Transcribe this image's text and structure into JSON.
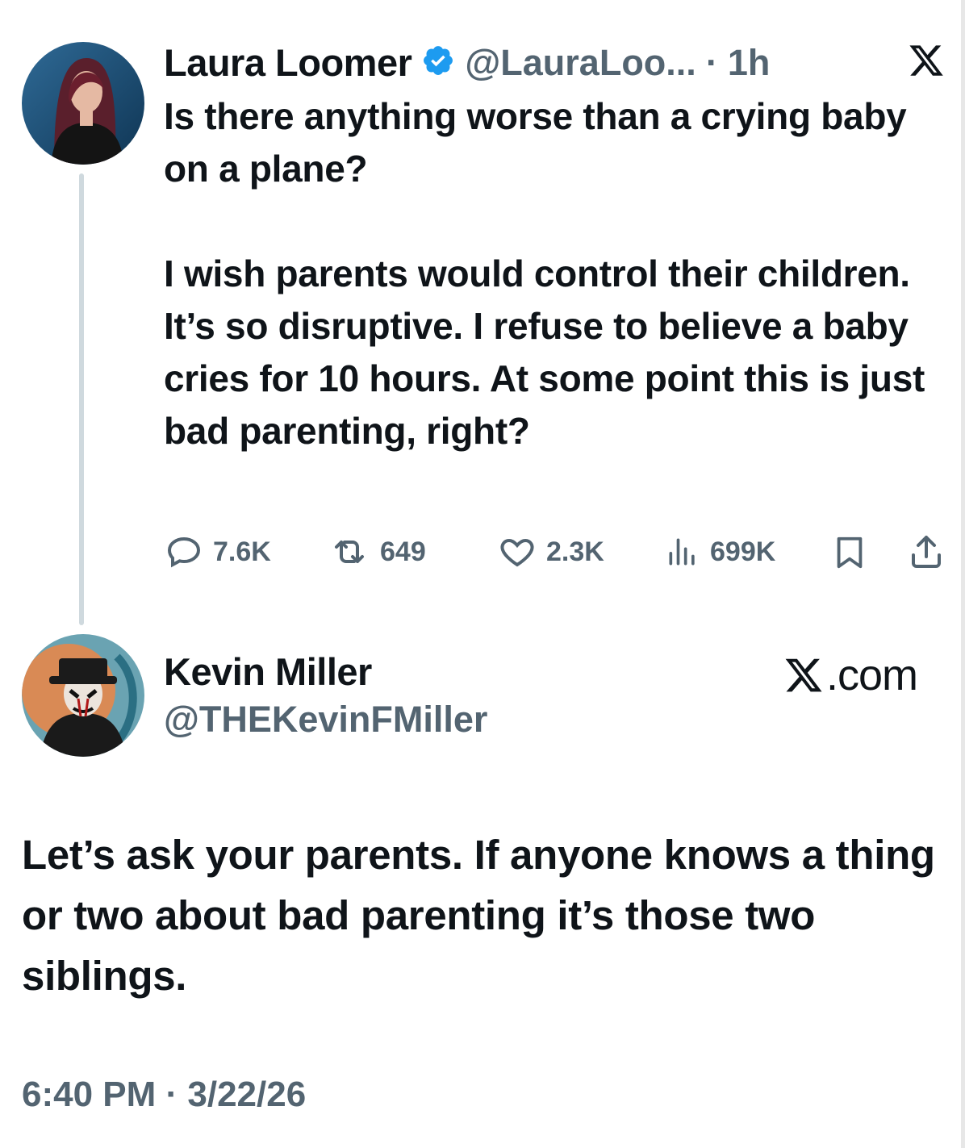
{
  "original_tweet": {
    "author_name": "Laura Loomer",
    "author_handle": "@LauraLoo...",
    "separator": "·",
    "time_ago": "1h",
    "text": "Is there anything worse than a crying baby on a plane?\n\nI wish parents would control their children. It’s so disruptive. I refuse to believe a baby cries for 10 hours. At some point this is just bad parenting, right?",
    "verified": true,
    "metrics": {
      "replies": "7.6K",
      "reposts": "649",
      "likes": "2.3K",
      "views": "699K"
    }
  },
  "reply": {
    "author_name": "Kevin Miller",
    "author_handle": "@THEKevinFMiller",
    "text": "Let’s ask your parents. If anyone knows a thing or two about bad parenting it’s those two siblings.",
    "brand": "X.com",
    "timestamp": "6:40 PM · 3/22/26"
  },
  "colors": {
    "text": "#0f1419",
    "secondary": "#536471",
    "verified_blue": "#1d9bf0",
    "thread_line": "#cfd9de"
  },
  "icons": [
    "x-logo-icon",
    "verified-badge-icon",
    "reply-icon",
    "repost-icon",
    "like-icon",
    "views-icon",
    "bookmark-icon",
    "share-icon"
  ]
}
